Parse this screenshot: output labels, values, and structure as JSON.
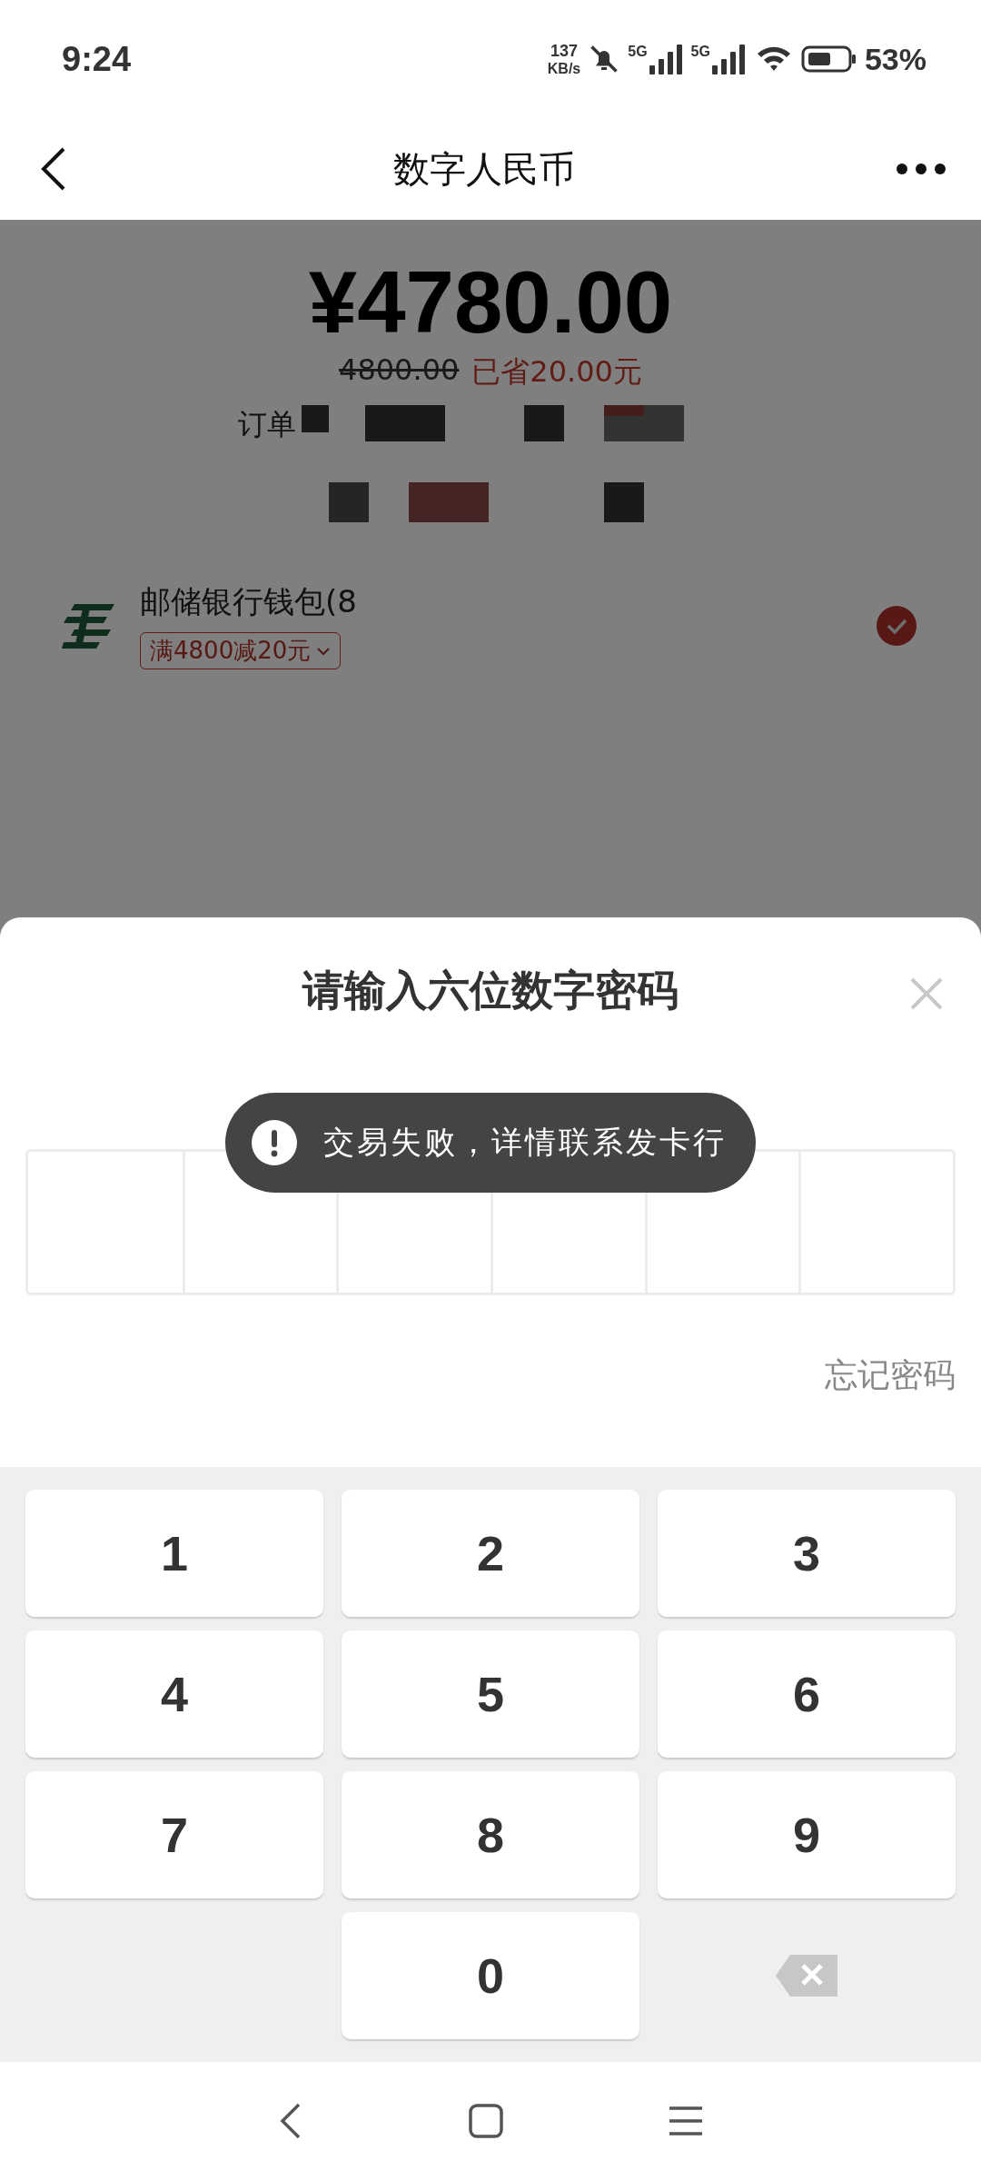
{
  "status_bar": {
    "time": "9:24",
    "net_speed": "137",
    "net_unit": "KB/s",
    "sim1": "5G",
    "sim2": "5G",
    "battery": "53%"
  },
  "nav": {
    "title": "数字人民币"
  },
  "order": {
    "amount": "¥4780.00",
    "original": "4800.00",
    "saving": "已省20.00元",
    "order_label": "订单"
  },
  "wallet": {
    "name": "邮储银行钱包(8",
    "promo": "满4800减20元",
    "selected": true
  },
  "sheet": {
    "title": "请输入六位数字密码",
    "forgot": "忘记密码"
  },
  "toast": {
    "text": "交易失败，详情联系发卡行"
  },
  "keypad": [
    {
      "kind": "digit",
      "label": "1"
    },
    {
      "kind": "digit",
      "label": "2"
    },
    {
      "kind": "digit",
      "label": "3"
    },
    {
      "kind": "digit",
      "label": "4"
    },
    {
      "kind": "digit",
      "label": "5"
    },
    {
      "kind": "digit",
      "label": "6"
    },
    {
      "kind": "digit",
      "label": "7"
    },
    {
      "kind": "digit",
      "label": "8"
    },
    {
      "kind": "digit",
      "label": "9"
    },
    {
      "kind": "blank"
    },
    {
      "kind": "digit",
      "label": "0"
    },
    {
      "kind": "backspace"
    }
  ]
}
